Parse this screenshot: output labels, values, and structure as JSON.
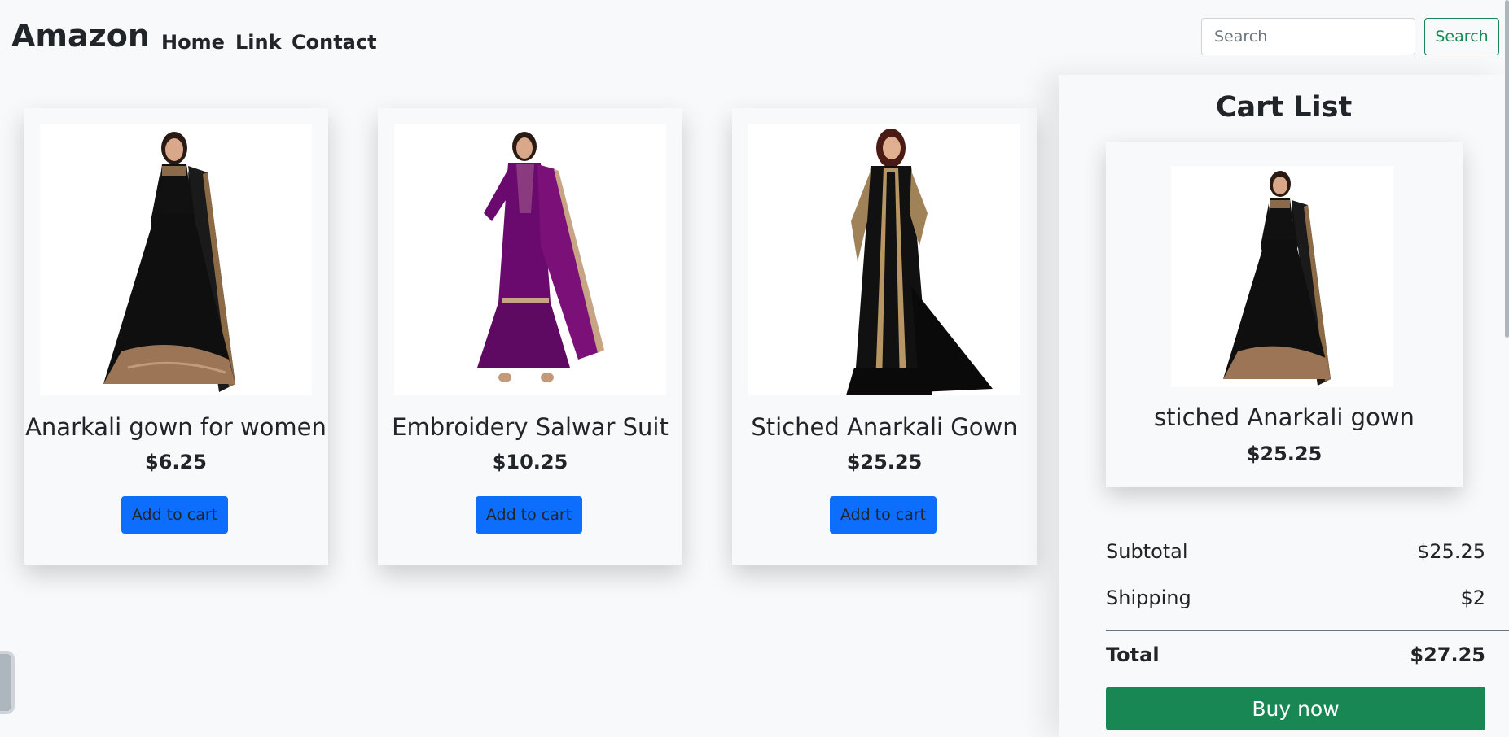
{
  "navbar": {
    "brand": "Amazon",
    "links": [
      "Home",
      "Link",
      "Contact"
    ],
    "search_placeholder": "Search",
    "search_button": "Search"
  },
  "products": [
    {
      "title": "Anarkali gown for women",
      "price": "$6.25",
      "button": "Add to cart",
      "image_icon": "black-anarkali-gown-image"
    },
    {
      "title": "Embroidery Salwar Suit",
      "price": "$10.25",
      "button": "Add to cart",
      "image_icon": "purple-salwar-suit-image"
    },
    {
      "title": "Stiched Anarkali Gown",
      "price": "$25.25",
      "button": "Add to cart",
      "image_icon": "black-gold-anarkali-image"
    }
  ],
  "cart": {
    "title": "Cart List",
    "item": {
      "name": "stiched Anarkali gown",
      "price": "$25.25",
      "image_icon": "black-anarkali-gown-image"
    },
    "subtotal_label": "Subtotal",
    "subtotal_value": "$25.25",
    "shipping_label": "Shipping",
    "shipping_value": "$2",
    "total_label": "Total",
    "total_value": "$27.25",
    "buy_button": "Buy now"
  },
  "colors": {
    "primary": "#0d6efd",
    "success": "#198754",
    "background": "#f8f9fa"
  }
}
